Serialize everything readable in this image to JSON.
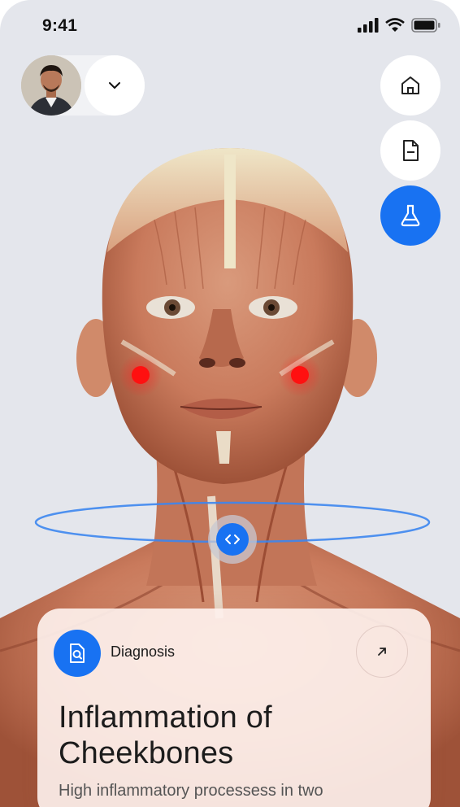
{
  "status_bar": {
    "time": "9:41",
    "signal_icon": "signal-icon",
    "wifi_icon": "wifi-icon",
    "battery_icon": "battery-icon"
  },
  "profile": {
    "avatar_icon": "avatar",
    "dropdown_icon": "chevron-down-icon"
  },
  "side_nav": [
    {
      "name": "home",
      "icon": "home-icon",
      "active": false
    },
    {
      "name": "document",
      "icon": "document-icon",
      "active": false
    },
    {
      "name": "lab",
      "icon": "flask-icon",
      "active": true
    }
  ],
  "rotate_control": {
    "icon": "code-arrows-icon"
  },
  "markers": [
    {
      "side": "left"
    },
    {
      "side": "right"
    }
  ],
  "diagnosis_card": {
    "label": "Diagnosis",
    "badge_icon": "document-search-icon",
    "arrow_icon": "arrow-up-right-icon",
    "title": "Inflammation of Cheekbones",
    "description": "High inflammatory processess in two"
  },
  "colors": {
    "accent": "#1872f2",
    "marker": "#ff1010",
    "background": "#e4e6ec"
  }
}
